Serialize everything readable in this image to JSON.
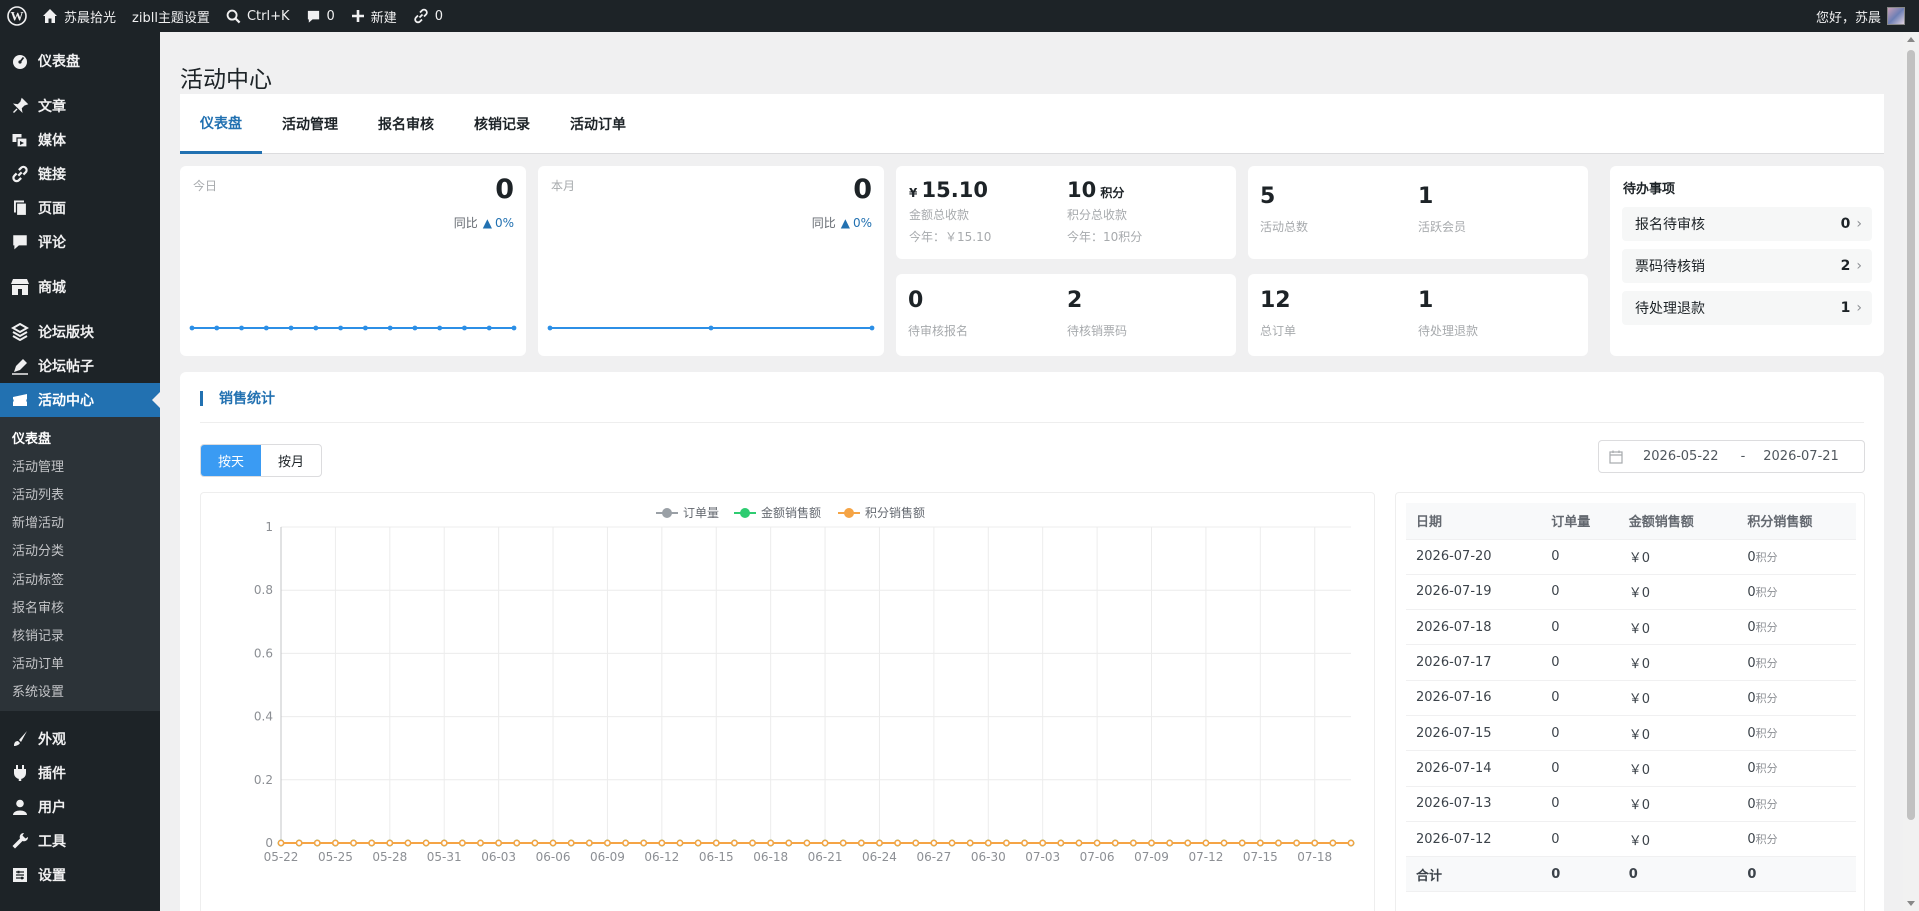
{
  "admin_bar": {
    "site_name": "苏晨拾光",
    "theme_settings": "zibll主题设置",
    "search_shortcut": "Ctrl+K",
    "comments_count": "0",
    "new_label": "新建",
    "links_count": "0",
    "greeting": "您好，苏晨"
  },
  "sidebar": {
    "items": [
      {
        "label": "仪表盘",
        "icon": "dashboard-icon"
      },
      {
        "label": "文章",
        "icon": "pin-icon"
      },
      {
        "label": "媒体",
        "icon": "media-icon"
      },
      {
        "label": "链接",
        "icon": "link-icon"
      },
      {
        "label": "页面",
        "icon": "page-icon"
      },
      {
        "label": "评论",
        "icon": "comment-icon"
      },
      {
        "label": "商城",
        "icon": "store-icon"
      },
      {
        "label": "论坛版块",
        "icon": "forum-icon"
      },
      {
        "label": "论坛帖子",
        "icon": "post-icon"
      },
      {
        "label": "活动中心",
        "icon": "event-icon"
      },
      {
        "label": "外观",
        "icon": "brush-icon"
      },
      {
        "label": "插件",
        "icon": "plugin-icon"
      },
      {
        "label": "用户",
        "icon": "user-icon"
      },
      {
        "label": "工具",
        "icon": "wrench-icon"
      },
      {
        "label": "设置",
        "icon": "settings-icon"
      }
    ],
    "submenu": [
      "仪表盘",
      "活动管理",
      "活动列表",
      "新增活动",
      "活动分类",
      "活动标签",
      "报名审核",
      "核销记录",
      "活动订单",
      "系统设置"
    ]
  },
  "page": {
    "title": "活动中心"
  },
  "tabs": [
    "仪表盘",
    "活动管理",
    "报名审核",
    "核销记录",
    "活动订单"
  ],
  "cards": {
    "today": {
      "label": "今日",
      "value": "0",
      "compare_label": "同比",
      "compare_value": "0%"
    },
    "month": {
      "label": "本月",
      "value": "0",
      "compare_label": "同比",
      "compare_value": "0%"
    },
    "money": {
      "currency": "¥",
      "value": "15.10",
      "label": "金额总收款",
      "year": "今年：￥15.10"
    },
    "points": {
      "value": "10",
      "unit": "积分",
      "label": "积分总收款",
      "year": "今年：10积分"
    },
    "events": {
      "value": "5",
      "label": "活动总数"
    },
    "members": {
      "value": "1",
      "label": "活跃会员"
    },
    "pending_reg": {
      "value": "0",
      "label": "待审核报名"
    },
    "pending_tickets": {
      "value": "2",
      "label": "待核销票码"
    },
    "orders": {
      "value": "12",
      "label": "总订单"
    },
    "refunds": {
      "value": "1",
      "label": "待处理退款"
    }
  },
  "todo": {
    "title": "待办事项",
    "items": [
      {
        "label": "报名待审核",
        "count": "0"
      },
      {
        "label": "票码待核销",
        "count": "2"
      },
      {
        "label": "待处理退款",
        "count": "1"
      }
    ]
  },
  "sales": {
    "title": "销售统计",
    "toggle": [
      "按天",
      "按月"
    ],
    "date_from": "2026-05-22",
    "date_sep": "-",
    "date_to": "2026-07-21"
  },
  "table": {
    "headers": [
      "日期",
      "订单量",
      "金额销售额",
      "积分销售额"
    ],
    "rows": [
      [
        "2026-07-20",
        "0",
        "￥0",
        "0"
      ],
      [
        "2026-07-19",
        "0",
        "￥0",
        "0"
      ],
      [
        "2026-07-18",
        "0",
        "￥0",
        "0"
      ],
      [
        "2026-07-17",
        "0",
        "￥0",
        "0"
      ],
      [
        "2026-07-16",
        "0",
        "￥0",
        "0"
      ],
      [
        "2026-07-15",
        "0",
        "￥0",
        "0"
      ],
      [
        "2026-07-14",
        "0",
        "￥0",
        "0"
      ],
      [
        "2026-07-13",
        "0",
        "￥0",
        "0"
      ],
      [
        "2026-07-12",
        "0",
        "￥0",
        "0"
      ]
    ],
    "points_unit": "积分",
    "total": [
      "合计",
      "0",
      "0",
      "0"
    ]
  },
  "colors": {
    "accent": "#2271b1",
    "orders_series": "#9aa0a6",
    "money_series": "#2ecc71",
    "points_series": "#f5a445",
    "sparkline": "#2c8fe6"
  },
  "chart_data": {
    "type": "line",
    "x": [
      "05-22",
      "05-23",
      "05-24",
      "05-25",
      "05-26",
      "05-27",
      "05-28",
      "05-29",
      "05-30",
      "05-31",
      "06-01",
      "06-02",
      "06-03",
      "06-04",
      "06-05",
      "06-06",
      "06-07",
      "06-08",
      "06-09",
      "06-10",
      "06-11",
      "06-12",
      "06-13",
      "06-14",
      "06-15",
      "06-16",
      "06-17",
      "06-18",
      "06-19",
      "06-20",
      "06-21",
      "06-22",
      "06-23",
      "06-24",
      "06-25",
      "06-26",
      "06-27",
      "06-28",
      "06-29",
      "06-30",
      "07-01",
      "07-02",
      "07-03",
      "07-04",
      "07-05",
      "07-06",
      "07-07",
      "07-08",
      "07-09",
      "07-10",
      "07-11",
      "07-12",
      "07-13",
      "07-14",
      "07-15",
      "07-16",
      "07-17",
      "07-18",
      "07-19",
      "07-20"
    ],
    "x_ticks": [
      "05-22",
      "05-25",
      "05-28",
      "05-31",
      "06-03",
      "06-06",
      "06-09",
      "06-12",
      "06-15",
      "06-18",
      "06-21",
      "06-24",
      "06-27",
      "06-30",
      "07-03",
      "07-06",
      "07-09",
      "07-12",
      "07-15",
      "07-18"
    ],
    "y_ticks": [
      "0",
      "0.2",
      "0.4",
      "0.6",
      "0.8",
      "1"
    ],
    "ylim": [
      0,
      1
    ],
    "grid": true,
    "legend_position": "top-center",
    "series": [
      {
        "name": "订单量",
        "color": "#9aa0a6",
        "values": "zeros"
      },
      {
        "name": "金额销售额",
        "color": "#2ecc71",
        "values": "zeros"
      },
      {
        "name": "积分销售额",
        "color": "#f5a445",
        "values": "zeros"
      }
    ],
    "sparklines": {
      "today_points": 14,
      "today_values": [
        0,
        0,
        0,
        0,
        0,
        0,
        0,
        0,
        0,
        0,
        0,
        0,
        0,
        0
      ],
      "month_points": 3,
      "month_values": [
        0,
        0,
        0
      ]
    }
  }
}
